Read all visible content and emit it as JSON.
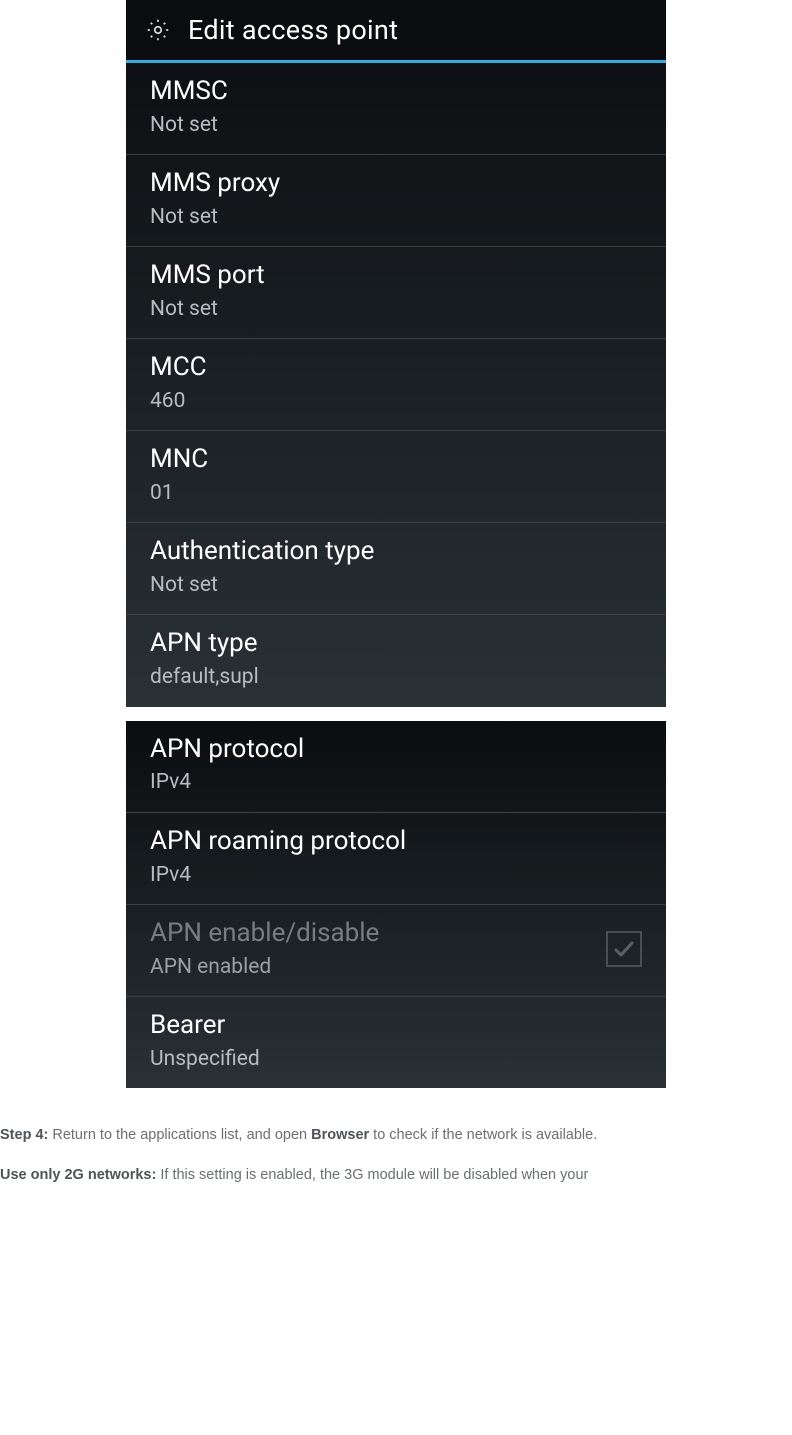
{
  "shot1": {
    "title": "Edit access point",
    "items": [
      {
        "label": "MMSC",
        "value": "Not set"
      },
      {
        "label": "MMS proxy",
        "value": "Not set"
      },
      {
        "label": "MMS port",
        "value": "Not set"
      },
      {
        "label": "MCC",
        "value": "460"
      },
      {
        "label": "MNC",
        "value": "01"
      },
      {
        "label": "Authentication type",
        "value": "Not set"
      },
      {
        "label": "APN type",
        "value": "default,supl"
      }
    ]
  },
  "shot2": {
    "items": [
      {
        "label": "APN protocol",
        "value": "IPv4"
      },
      {
        "label": "APN roaming protocol",
        "value": "IPv4"
      },
      {
        "label": "APN enable/disable",
        "value": "APN enabled"
      },
      {
        "label": "Bearer",
        "value": "Unspecified"
      }
    ]
  },
  "prose": {
    "step4": {
      "b1": "Step 4:",
      "t1": " Return to the applications list, and open ",
      "b2": "Browser",
      "t2": " to check if the network is available."
    },
    "use2g": {
      "b1": "Use only 2G networks:",
      "t1": " If this setting is enabled, the 3G module will be disabled when your"
    }
  }
}
